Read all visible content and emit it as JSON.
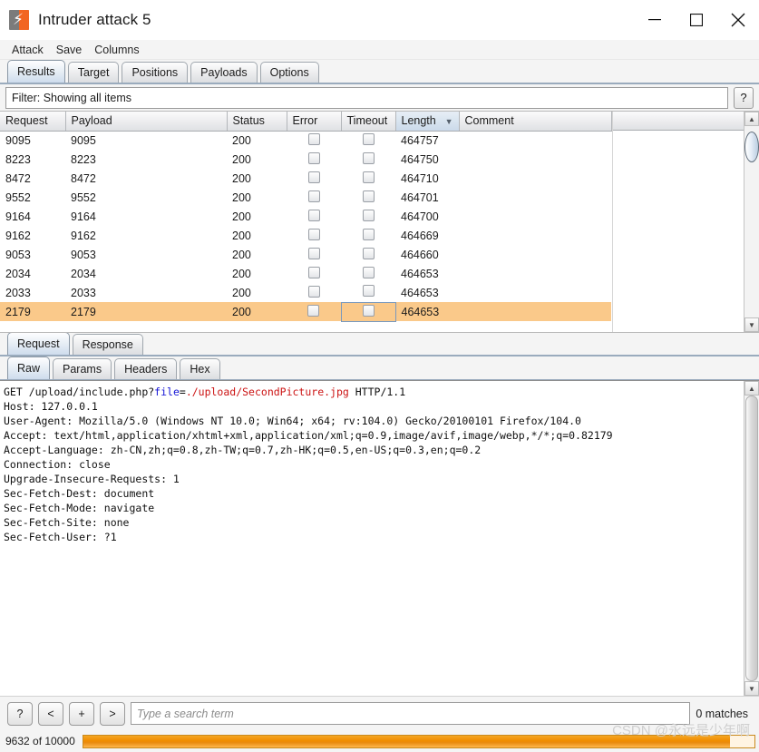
{
  "window": {
    "title": "Intruder attack 5",
    "icon": "burp-suite-icon",
    "minimize": "—",
    "maximize": "☐",
    "close": "✕"
  },
  "menubar": {
    "items": [
      {
        "label": "Attack"
      },
      {
        "label": "Save"
      },
      {
        "label": "Columns"
      }
    ]
  },
  "tabs": {
    "items": [
      {
        "label": "Results",
        "active": true
      },
      {
        "label": "Target",
        "active": false
      },
      {
        "label": "Positions",
        "active": false
      },
      {
        "label": "Payloads",
        "active": false
      },
      {
        "label": "Options",
        "active": false
      }
    ]
  },
  "filter": {
    "text": "Filter: Showing all items",
    "help_label": "?"
  },
  "results_table": {
    "columns": [
      {
        "label": "Request",
        "sorted": false
      },
      {
        "label": "Payload",
        "sorted": false
      },
      {
        "label": "Status",
        "sorted": false
      },
      {
        "label": "Error",
        "sorted": false
      },
      {
        "label": "Timeout",
        "sorted": false
      },
      {
        "label": "Length",
        "sorted": true,
        "sort_arrow": "▼"
      },
      {
        "label": "Comment",
        "sorted": false
      }
    ],
    "rows": [
      {
        "request": "9095",
        "payload": "9095",
        "status": "200",
        "error": "",
        "timeout": "",
        "length": "464757",
        "comment": "",
        "selected": false
      },
      {
        "request": "8223",
        "payload": "8223",
        "status": "200",
        "error": "",
        "timeout": "",
        "length": "464750",
        "comment": "",
        "selected": false
      },
      {
        "request": "8472",
        "payload": "8472",
        "status": "200",
        "error": "",
        "timeout": "",
        "length": "464710",
        "comment": "",
        "selected": false
      },
      {
        "request": "9552",
        "payload": "9552",
        "status": "200",
        "error": "",
        "timeout": "",
        "length": "464701",
        "comment": "",
        "selected": false
      },
      {
        "request": "9164",
        "payload": "9164",
        "status": "200",
        "error": "",
        "timeout": "",
        "length": "464700",
        "comment": "",
        "selected": false
      },
      {
        "request": "9162",
        "payload": "9162",
        "status": "200",
        "error": "",
        "timeout": "",
        "length": "464669",
        "comment": "",
        "selected": false
      },
      {
        "request": "9053",
        "payload": "9053",
        "status": "200",
        "error": "",
        "timeout": "",
        "length": "464660",
        "comment": "",
        "selected": false
      },
      {
        "request": "2034",
        "payload": "2034",
        "status": "200",
        "error": "",
        "timeout": "",
        "length": "464653",
        "comment": "",
        "selected": false
      },
      {
        "request": "2033",
        "payload": "2033",
        "status": "200",
        "error": "",
        "timeout": "",
        "length": "464653",
        "comment": "",
        "selected": false
      },
      {
        "request": "2179",
        "payload": "2179",
        "status": "200",
        "error": "",
        "timeout": "",
        "length": "464653",
        "comment": "",
        "selected": true
      }
    ]
  },
  "message_tabs": {
    "items": [
      {
        "label": "Request",
        "active": true
      },
      {
        "label": "Response",
        "active": false
      }
    ]
  },
  "view_tabs": {
    "items": [
      {
        "label": "Raw",
        "active": true
      },
      {
        "label": "Params",
        "active": false
      },
      {
        "label": "Headers",
        "active": false
      },
      {
        "label": "Hex",
        "active": false
      }
    ]
  },
  "request": {
    "line_method": "GET /upload/include.php?",
    "line_param_name": "file",
    "line_eq": "=",
    "line_param_value": "./upload/SecondPicture.jpg",
    "line_proto": " HTTP/1.1",
    "headers": [
      "Host: 127.0.0.1",
      "User-Agent: Mozilla/5.0 (Windows NT 10.0; Win64; x64; rv:104.0) Gecko/20100101 Firefox/104.0",
      "Accept: text/html,application/xhtml+xml,application/xml;q=0.9,image/avif,image/webp,*/*;q=0.82179",
      "Accept-Language: zh-CN,zh;q=0.8,zh-TW;q=0.7,zh-HK;q=0.5,en-US;q=0.3,en;q=0.2",
      "Connection: close",
      "Upgrade-Insecure-Requests: 1",
      "Sec-Fetch-Dest: document",
      "Sec-Fetch-Mode: navigate",
      "Sec-Fetch-Site: none",
      "Sec-Fetch-User: ?1"
    ]
  },
  "search": {
    "help_label": "?",
    "prev_label": "<",
    "add_label": "+",
    "next_label": ">",
    "placeholder": "Type a search term",
    "value": "",
    "matches": "0 matches"
  },
  "status": {
    "count": "9632 of 10000",
    "progress_percent": 96.32,
    "watermark": "CSDN @永远是少年啊"
  },
  "colors": {
    "accent_orange": "#f08c00",
    "selection_row": "#fac98a",
    "tab_active": "#cedced",
    "param_name": "#1414d6",
    "param_value": "#cc1414"
  }
}
